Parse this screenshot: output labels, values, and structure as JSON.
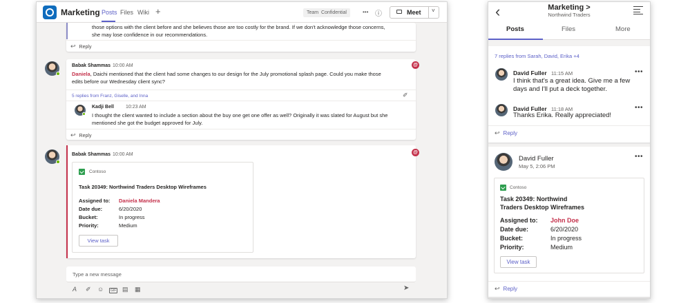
{
  "desktop": {
    "channel": "Marketing",
    "tabs": [
      "Posts",
      "Files",
      "Wiki"
    ],
    "add_tab": "+",
    "sensitivity": {
      "team": "Team",
      "label": "Confidential"
    },
    "more": "•••",
    "info": "ⓘ",
    "meet_label": "Meet",
    "meet_chevron": "˅",
    "truncated_text_1": "those options with the client before and she believes those are too costly for the brand. If we don't acknowledge those concerns,",
    "truncated_text_2": "she may lose confidence in our recommendations.",
    "reply_label": "Reply",
    "reply_arrow": "↩",
    "posts": [
      {
        "author": "Babak Shammas",
        "time": "10:00 AM",
        "mention": "Daniela",
        "text_line1": ", Daichi mentioned that the client had some changes to our design for the July promotional splash page. Could you make those",
        "text_line2": "edits before our Wednesday client sync?",
        "replies_summary": "5 replies from Franz, Giselle, and Inna",
        "reply": {
          "author": "Kadji Bell",
          "time": "10:23 AM",
          "text_line1": "I thought the client wanted to include a section about the buy one get one offer as well? Originally it was slated for August but she",
          "text_line2": "mentioned she got the budget approved for July."
        }
      },
      {
        "author": "Babak Shammas",
        "time": "10:00 AM",
        "card": {
          "app": "Contoso",
          "title": "Task 20349: Northwind Traders Desktop Wireframes",
          "fields": [
            {
              "k": "Assigned to:",
              "v": "Daniela Mandera"
            },
            {
              "k": "Date due:",
              "v": "6/20/2020"
            },
            {
              "k": "Bucket:",
              "v": "In progress"
            },
            {
              "k": "Priority:",
              "v": "Medium"
            }
          ],
          "button": "View task"
        }
      }
    ],
    "compose_placeholder": "Type a new message",
    "toolbar_icons": [
      "A",
      "✐",
      "☺",
      "GIF",
      "▤",
      "▦"
    ],
    "send_icon": "➤",
    "at_symbol": "@",
    "attach_icon": "✐"
  },
  "mobile": {
    "title": "Marketing >",
    "subtitle": "Northwind Traders",
    "back": "‹",
    "tabs": [
      "Posts",
      "Files",
      "More"
    ],
    "replies_summary": "7 replies from Sarah, David, Erika +4",
    "messages": [
      {
        "author": "David Fuller",
        "time": "11:15 AM",
        "line1": "I think that's a great idea. Give me a few",
        "line2": "days and I'll put a deck together."
      },
      {
        "author": "David Fuller",
        "time": "11:18 AM",
        "line1": "Thanks Erika. Really appreciated!",
        "line2": ""
      }
    ],
    "more": "•••",
    "reply_label": "Reply",
    "reply_arrow": "↩",
    "post": {
      "author": "David Fuller",
      "date": "May 5, 2:06 PM",
      "card": {
        "app": "Contoso",
        "title_line1": "Task 20349: Northwind",
        "title_line2": "Traders Desktop Wireframes",
        "fields": [
          {
            "k": "Assigned to:",
            "v": "John Doe"
          },
          {
            "k": "Date due:",
            "v": "6/20/2020"
          },
          {
            "k": "Bucket:",
            "v": "In progress"
          },
          {
            "k": "Priority:",
            "v": "Medium"
          }
        ],
        "button": "View task"
      }
    }
  },
  "colors": {
    "accent": "#5b5fc7",
    "mention": "#c4314b",
    "presence": "#6bb700",
    "app_logo": "#2e9e4f"
  }
}
